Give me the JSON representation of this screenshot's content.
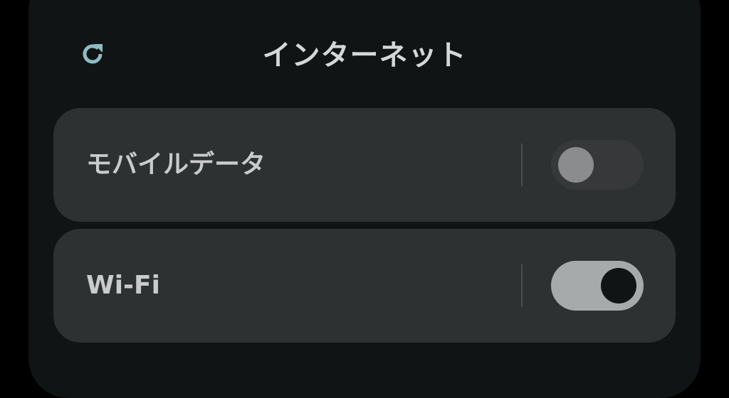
{
  "header": {
    "title": "インターネット",
    "refresh_icon": "refresh-icon"
  },
  "toggles": [
    {
      "label": "モバイルデータ",
      "state": "off"
    },
    {
      "label": "Wi-Fi",
      "state": "on"
    }
  ],
  "colors": {
    "panel_bg": "#111415",
    "card_bg": "#2e3132",
    "accent_icon": "#8fbcc4",
    "toggle_on_track": "#a7aaab",
    "toggle_off_track": "#363839"
  }
}
